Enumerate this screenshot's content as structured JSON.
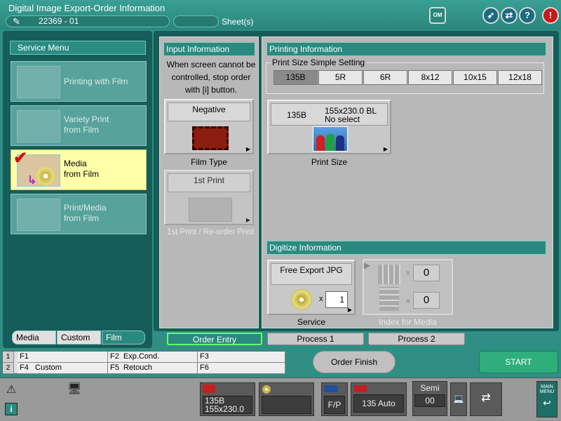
{
  "title_bar": {
    "title": "Digital Image Export-Order Information",
    "order_number": "22369  - 01",
    "sheet_value": "",
    "sheet_label": "Sheet(s)",
    "buttons": [
      {
        "name": "om-icon",
        "glyph": "OM"
      },
      {
        "name": "rocket-icon",
        "glyph": "➶"
      },
      {
        "name": "swap-arrows-icon",
        "glyph": "⇄"
      },
      {
        "name": "help-icon",
        "glyph": "?"
      },
      {
        "name": "alert-icon",
        "glyph": "!"
      }
    ]
  },
  "service_menu": {
    "header": "Service Menu",
    "items": [
      {
        "label": "Printing with Film",
        "active": false
      },
      {
        "label": "Variety Print\nfrom Film",
        "active": false
      },
      {
        "label": "Media\nfrom Film",
        "active": true
      },
      {
        "label": "Print/Media\nfrom Film",
        "active": false
      }
    ],
    "tabs": [
      "Media",
      "Custom",
      "Film"
    ]
  },
  "input_info": {
    "header": "Input Information",
    "message": "When screen cannot be controlled, stop order with [i] button.",
    "film_type_value": "Negative",
    "film_type_label": "Film Type",
    "print_value": "1st Print",
    "print_label": "1st Print / Re-order Print"
  },
  "printing_info": {
    "header": "Printing Information",
    "simple_setting_label": "Print Size Simple Setting",
    "sizes": [
      "135B",
      "5R",
      "6R",
      "8x12",
      "10x15",
      "12x18"
    ],
    "selected_size": "135B",
    "print_size_code": "135B",
    "print_size_dims": "155x230.0 BL",
    "print_size_select": "No select",
    "print_size_label": "Print Size"
  },
  "digitize_info": {
    "header": "Digitize Information",
    "service_value": "Free Export JPG",
    "service_count": "1",
    "service_label": "Service",
    "index_count_1": "0",
    "index_count_2": "0",
    "index_label": "Index for Media",
    "multiplier": "x"
  },
  "bottom_tabs": [
    "Order Entry",
    "Process 1",
    "Process 2"
  ],
  "function_keys": {
    "row_numbers": [
      "1",
      "2"
    ],
    "row1": [
      {
        "key": "F1",
        "label": ""
      },
      {
        "key": "F2",
        "label": "Exp.Cond."
      },
      {
        "key": "F3",
        "label": ""
      }
    ],
    "row2": [
      {
        "key": "F4",
        "label": "Custom"
      },
      {
        "key": "F5",
        "label": "Retouch"
      },
      {
        "key": "F6",
        "label": ""
      }
    ]
  },
  "actions": {
    "order_finish": "Order Finish",
    "start": "START"
  },
  "status_bar": {
    "film_size": "135B",
    "film_dims": "155x230.0",
    "fp_label": "F/P",
    "auto_label": "135 Auto",
    "mode_label": "Semi",
    "mode_value": "00",
    "main_menu": "MAIN MENU"
  }
}
